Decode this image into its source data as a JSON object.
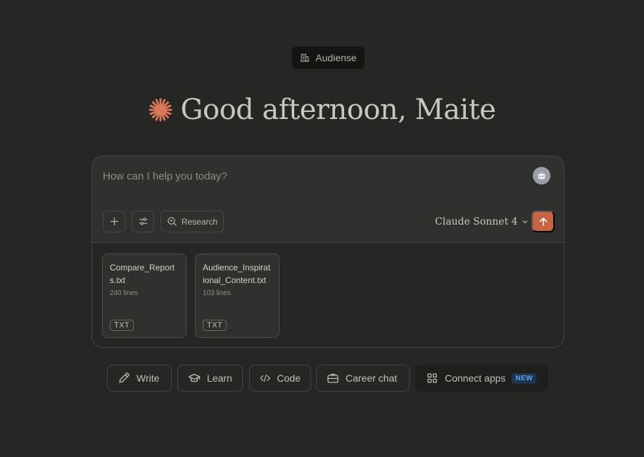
{
  "org": {
    "name": "Audiense",
    "icon": "building-icon"
  },
  "greeting": {
    "text": "Good afternoon, Maite",
    "icon": "claude-star-icon",
    "icon_color": "#d97757"
  },
  "composer": {
    "placeholder": "How can I help you today?",
    "tools": {
      "research_label": "Research"
    },
    "model": "Claude Sonnet 4",
    "send_color": "#c96442"
  },
  "attachments": [
    {
      "name": "Compare_Reports.txt",
      "lines": "240 lines",
      "type": "TXT"
    },
    {
      "name": "Audience_Inspirational_Content.txt",
      "lines": "103 lines",
      "type": "TXT"
    }
  ],
  "actions": {
    "write": "Write",
    "learn": "Learn",
    "code": "Code",
    "career": "Career chat",
    "connect": "Connect apps",
    "connect_badge": "NEW"
  }
}
